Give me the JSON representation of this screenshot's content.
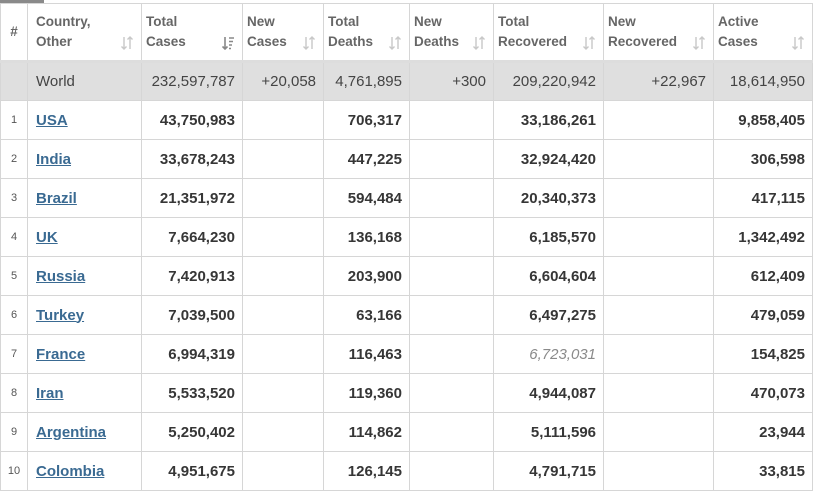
{
  "columns": [
    {
      "l1": "#",
      "l2": ""
    },
    {
      "l1": "Country,",
      "l2": "Other"
    },
    {
      "l1": "Total",
      "l2": "Cases"
    },
    {
      "l1": "New",
      "l2": "Cases"
    },
    {
      "l1": "Total",
      "l2": "Deaths"
    },
    {
      "l1": "New",
      "l2": "Deaths"
    },
    {
      "l1": "Total",
      "l2": "Recovered"
    },
    {
      "l1": "New",
      "l2": "Recovered"
    },
    {
      "l1": "Active",
      "l2": "Cases"
    }
  ],
  "world": {
    "name": "World",
    "total_cases": "232,597,787",
    "new_cases": "+20,058",
    "total_deaths": "4,761,895",
    "new_deaths": "+300",
    "total_recovered": "209,220,942",
    "new_recovered": "+22,967",
    "active_cases": "18,614,950"
  },
  "rows": [
    {
      "rank": "1",
      "country": "USA",
      "total_cases": "43,750,983",
      "new_cases": "",
      "total_deaths": "706,317",
      "new_deaths": "",
      "total_recovered": "33,186,261",
      "new_recovered": "",
      "active_cases": "9,858,405"
    },
    {
      "rank": "2",
      "country": "India",
      "total_cases": "33,678,243",
      "new_cases": "",
      "total_deaths": "447,225",
      "new_deaths": "",
      "total_recovered": "32,924,420",
      "new_recovered": "",
      "active_cases": "306,598"
    },
    {
      "rank": "3",
      "country": "Brazil",
      "total_cases": "21,351,972",
      "new_cases": "",
      "total_deaths": "594,484",
      "new_deaths": "",
      "total_recovered": "20,340,373",
      "new_recovered": "",
      "active_cases": "417,115"
    },
    {
      "rank": "4",
      "country": "UK",
      "total_cases": "7,664,230",
      "new_cases": "",
      "total_deaths": "136,168",
      "new_deaths": "",
      "total_recovered": "6,185,570",
      "new_recovered": "",
      "active_cases": "1,342,492"
    },
    {
      "rank": "5",
      "country": "Russia",
      "total_cases": "7,420,913",
      "new_cases": "",
      "total_deaths": "203,900",
      "new_deaths": "",
      "total_recovered": "6,604,604",
      "new_recovered": "",
      "active_cases": "612,409"
    },
    {
      "rank": "6",
      "country": "Turkey",
      "total_cases": "7,039,500",
      "new_cases": "",
      "total_deaths": "63,166",
      "new_deaths": "",
      "total_recovered": "6,497,275",
      "new_recovered": "",
      "active_cases": "479,059"
    },
    {
      "rank": "7",
      "country": "France",
      "total_cases": "6,994,319",
      "new_cases": "",
      "total_deaths": "116,463",
      "new_deaths": "",
      "total_recovered": "6,723,031",
      "new_recovered": "",
      "active_cases": "154,825",
      "recovered_estimated": true
    },
    {
      "rank": "8",
      "country": "Iran",
      "total_cases": "5,533,520",
      "new_cases": "",
      "total_deaths": "119,360",
      "new_deaths": "",
      "total_recovered": "4,944,087",
      "new_recovered": "",
      "active_cases": "470,073"
    },
    {
      "rank": "9",
      "country": "Argentina",
      "total_cases": "5,250,402",
      "new_cases": "",
      "total_deaths": "114,862",
      "new_deaths": "",
      "total_recovered": "5,111,596",
      "new_recovered": "",
      "active_cases": "23,944"
    },
    {
      "rank": "10",
      "country": "Colombia",
      "total_cases": "4,951,675",
      "new_cases": "",
      "total_deaths": "126,145",
      "new_deaths": "",
      "total_recovered": "4,791,715",
      "new_recovered": "",
      "active_cases": "33,815"
    }
  ],
  "colors": {
    "link": "#3a6a92",
    "world_bg": "#dfdfdf",
    "border": "#d6d6d6",
    "header_text": "#666666",
    "estimated_text": "#8a8a8a"
  },
  "icons": {
    "sort": "sort-arrows-icon",
    "sort_active": "sort-descending-icon"
  }
}
